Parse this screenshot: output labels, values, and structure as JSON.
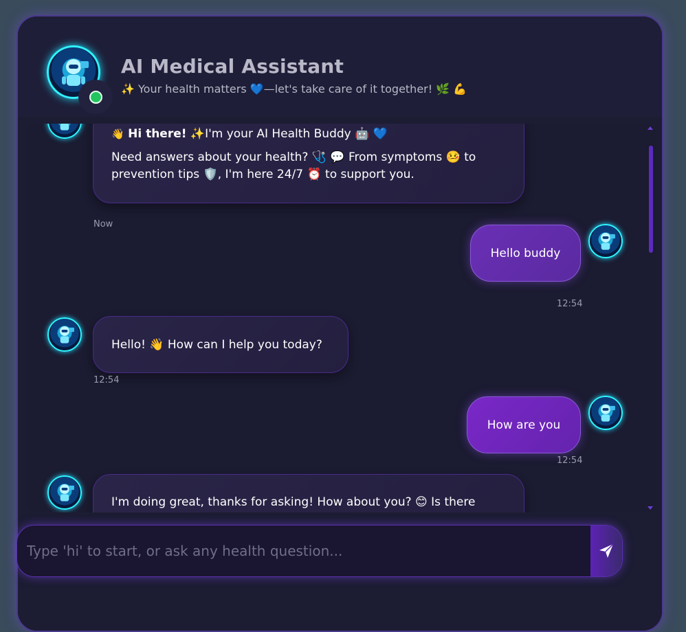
{
  "header": {
    "title": "AI Medical Assistant",
    "subtitle": "✨ Your health matters 💙—let's take care of it together! 🌿 💪"
  },
  "messages": [
    {
      "sender": "bot",
      "line1_bold": "Hi there!",
      "line1_rest": "✨I'm your AI Health Buddy 🤖 💙",
      "line1_prefix": "👋",
      "body": "Need answers about your health? 🩺 💬 From symptoms 🤒 to prevention tips 🛡️, I'm here 24/7 ⏰ to support you.",
      "time": "Now"
    },
    {
      "sender": "user",
      "text": "Hello buddy",
      "time": "12:54"
    },
    {
      "sender": "bot",
      "text": "Hello! 👋 How can I help you today?",
      "time": "12:54"
    },
    {
      "sender": "user",
      "text": "How are you",
      "time": "12:54"
    },
    {
      "sender": "bot",
      "text": "I'm doing great, thanks for asking! How about you? 😊 Is there anything health-related I can help you with?",
      "time": ""
    }
  ],
  "input": {
    "placeholder": "Type 'hi' to start, or ask any health question...",
    "value": ""
  },
  "icons": {
    "send": "send-icon",
    "avatar": "robot-avatar-icon",
    "status": "online-status-icon"
  },
  "colors": {
    "accent": "#6a2fb5",
    "online": "#22c55e",
    "avatar_ring": "#2ff3ff",
    "background": "#3a4b5c",
    "panel": "#1c1c33"
  }
}
